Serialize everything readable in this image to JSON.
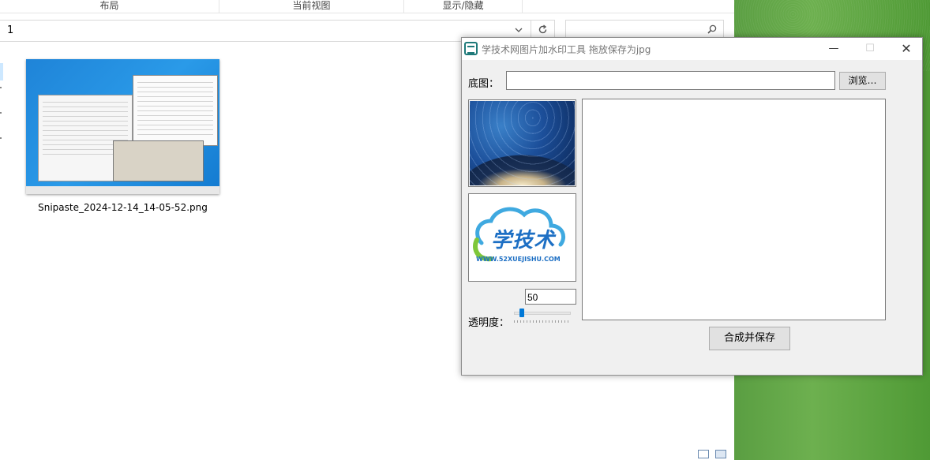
{
  "explorer": {
    "ribbon": [
      {
        "label": "布局"
      },
      {
        "label": "当前视图"
      },
      {
        "label": "显示/隐藏"
      }
    ],
    "address_value": "1",
    "search_placeholder": "",
    "file": {
      "name": "Snipaste_2024-12-14_14-05-52.png"
    }
  },
  "dialog": {
    "title": "学技术网图片加水印工具  拖放保存为jpg",
    "base_image_label": "底图：",
    "base_image_value": "",
    "browse_label": "浏览…",
    "watermark_logo": {
      "text": "学技术",
      "url": "WWW.52XUEJISHU.COM"
    },
    "opacity_label": "透明度：",
    "opacity_value": "50",
    "merge_save_label": "合成并保存",
    "controls": {
      "minimize": "—",
      "maximize": "☐",
      "close": "✕"
    }
  },
  "icons": {
    "refresh": "refresh-icon",
    "search": "search-icon",
    "dropdown": "chevron-down-icon",
    "app": "app-icon"
  }
}
